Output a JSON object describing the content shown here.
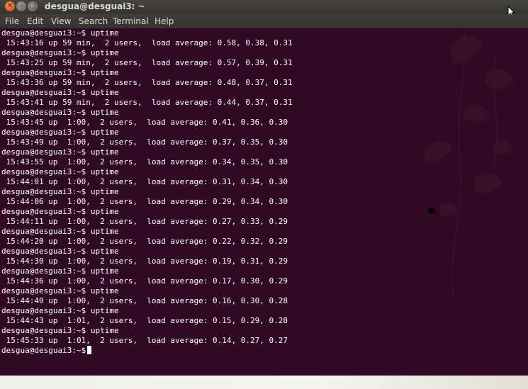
{
  "window": {
    "title": "desgua@desguai3: ~",
    "close_glyph": "✕",
    "minimize_glyph": "–",
    "maximize_glyph": "□"
  },
  "menu": {
    "file": "File",
    "edit": "Edit",
    "view": "View",
    "search": "Search",
    "terminal": "Terminal",
    "help": "Help"
  },
  "terminal": {
    "lines": [
      "desgua@desguai3:~$ uptime",
      " 15:43:16 up 59 min,  2 users,  load average: 0.58, 0.38, 0.31",
      "desgua@desguai3:~$ uptime",
      " 15:43:25 up 59 min,  2 users,  load average: 0.57, 0.39, 0.31",
      "desgua@desguai3:~$ uptime",
      " 15:43:36 up 59 min,  2 users,  load average: 0.48, 0.37, 0.31",
      "desgua@desguai3:~$ uptime",
      " 15:43:41 up 59 min,  2 users,  load average: 0.44, 0.37, 0.31",
      "desgua@desguai3:~$ uptime",
      " 15:43:45 up  1:00,  2 users,  load average: 0.41, 0.36, 0.30",
      "desgua@desguai3:~$ uptime",
      " 15:43:49 up  1:00,  2 users,  load average: 0.37, 0.35, 0.30",
      "desgua@desguai3:~$ uptime",
      " 15:43:55 up  1:00,  2 users,  load average: 0.34, 0.35, 0.30",
      "desgua@desguai3:~$ uptime",
      " 15:44:01 up  1:00,  2 users,  load average: 0.31, 0.34, 0.30",
      "desgua@desguai3:~$ uptime",
      " 15:44:06 up  1:00,  2 users,  load average: 0.29, 0.34, 0.30",
      "desgua@desguai3:~$ uptime",
      " 15:44:11 up  1:00,  2 users,  load average: 0.27, 0.33, 0.29",
      "desgua@desguai3:~$ uptime",
      " 15:44:20 up  1:00,  2 users,  load average: 0.22, 0.32, 0.29",
      "desgua@desguai3:~$ uptime",
      " 15:44:30 up  1:00,  2 users,  load average: 0.19, 0.31, 0.29",
      "desgua@desguai3:~$ uptime",
      " 15:44:36 up  1:00,  2 users,  load average: 0.17, 0.30, 0.29",
      "desgua@desguai3:~$ uptime",
      " 15:44:40 up  1:00,  2 users,  load average: 0.16, 0.30, 0.28",
      "desgua@desguai3:~$ uptime",
      " 15:44:43 up  1:01,  2 users,  load average: 0.15, 0.29, 0.28",
      "desgua@desguai3:~$ uptime",
      " 15:45:33 up  1:01,  2 users,  load average: 0.14, 0.27, 0.27"
    ],
    "prompt": "desgua@desguai3:~$",
    "background_color": "#300a24",
    "text_color": "#ffffff"
  }
}
